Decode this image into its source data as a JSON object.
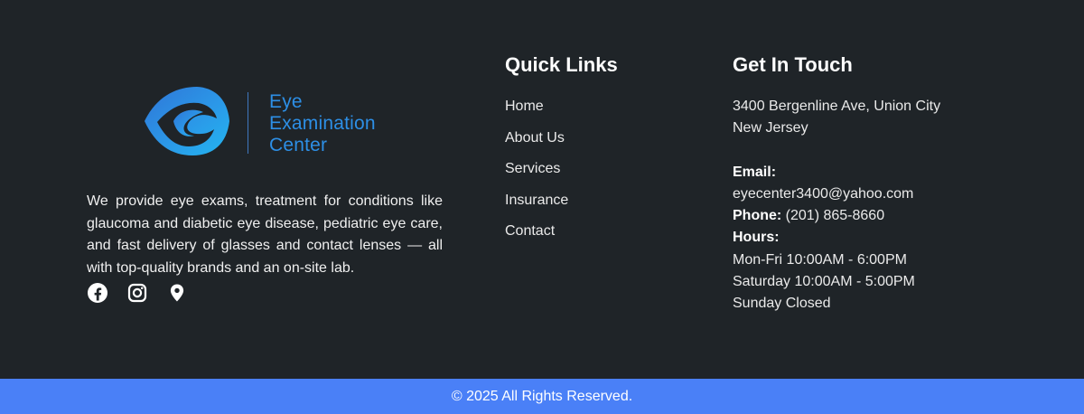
{
  "brand": {
    "logo_lines": [
      "Eye",
      "Examination",
      "Center"
    ],
    "description": "We provide eye exams, treatment for conditions like glaucoma and diabetic eye disease, pediatric eye care, and fast delivery of glasses and contact lenses — all with top-quality brands and an on-site lab.",
    "social_icons": [
      "facebook-icon",
      "instagram-icon",
      "location-pin-icon"
    ]
  },
  "quick_links": {
    "title": "Quick Links",
    "items": [
      "Home",
      "About Us",
      "Services",
      "Insurance",
      "Contact"
    ]
  },
  "contact": {
    "title": "Get In Touch",
    "address_line1": "3400 Bergenline Ave, Union City",
    "address_line2": "New Jersey",
    "email_label": "Email:",
    "email_value": "eyecenter3400@yahoo.com",
    "phone_label": "Phone:",
    "phone_value": "(201) 865-8660",
    "hours_label": "Hours:",
    "hours": [
      "Mon-Fri 10:00AM - 6:00PM",
      "Saturday 10:00AM - 5:00PM",
      "Sunday Closed"
    ]
  },
  "footer": {
    "copyright": "© 2025 All Rights Reserved."
  },
  "colors": {
    "background": "#1f2428",
    "brand_blue": "#2d8fe6",
    "bottom_bar": "#4a80f7",
    "text": "#eaeaea"
  }
}
